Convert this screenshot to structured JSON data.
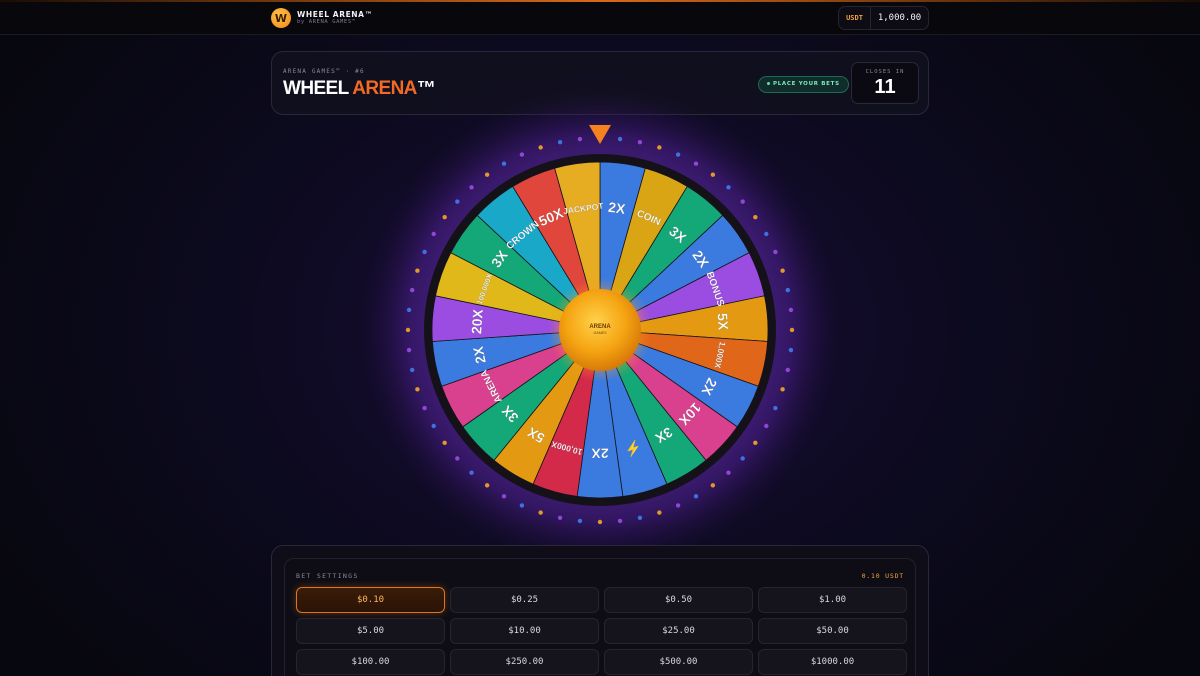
{
  "topbar": {
    "logo_letter": "W",
    "app_name": "WHEEL ARENA™",
    "app_by": "by ARENA GAMES™",
    "wallet_currency": "USDT",
    "wallet_balance": "1,000.00"
  },
  "header": {
    "round_label": "ARENA GAMES™ · #6",
    "title_part1": "WHEEL ",
    "title_part2": "ARENA",
    "title_tm": "™",
    "status_text": "PLACE YOUR BETS",
    "countdown_label": "CLOSES IN",
    "countdown_value": "11"
  },
  "wheel": {
    "hub_line1": "ARENA",
    "hub_line2": "GAMES",
    "pointer_color": "#f5821f",
    "segments": [
      {
        "label": "2X",
        "color": "#3b7be0"
      },
      {
        "label": "COIN",
        "color": "#d9a514"
      },
      {
        "label": "3X",
        "color": "#14a878"
      },
      {
        "label": "2X",
        "color": "#3b7be0"
      },
      {
        "label": "BONUS",
        "color": "#9a4de0"
      },
      {
        "label": "5X",
        "color": "#e39a12"
      },
      {
        "label": "1,000X",
        "color": "#e0661a"
      },
      {
        "label": "2X",
        "color": "#3b7be0"
      },
      {
        "label": "10X",
        "color": "#d9408e"
      },
      {
        "label": "3X",
        "color": "#14a878"
      },
      {
        "label": "⚡",
        "color": "#3b7be0"
      },
      {
        "label": "2X",
        "color": "#3b7be0"
      },
      {
        "label": "10,000X",
        "color": "#d42a4a"
      },
      {
        "label": "5X",
        "color": "#e39a12"
      },
      {
        "label": "3X",
        "color": "#14a878"
      },
      {
        "label": "ARENA",
        "color": "#d9408e"
      },
      {
        "label": "2X",
        "color": "#3b7be0"
      },
      {
        "label": "20X",
        "color": "#9a4de0"
      },
      {
        "label": "100,000X",
        "color": "#e0b81a"
      },
      {
        "label": "3X",
        "color": "#14a878"
      },
      {
        "label": "CROWN",
        "color": "#1aa8c8"
      },
      {
        "label": "50X",
        "color": "#e0463c"
      },
      {
        "label": "JACKPOT",
        "color": "#e6ac22"
      }
    ]
  },
  "bets": {
    "title": "BET SETTINGS",
    "current": "0.10 USDT",
    "options": [
      "$0.10",
      "$0.25",
      "$0.50",
      "$1.00",
      "$5.00",
      "$10.00",
      "$25.00",
      "$50.00",
      "$100.00",
      "$250.00",
      "$500.00",
      "$1000.00"
    ],
    "selected_index": 0
  }
}
